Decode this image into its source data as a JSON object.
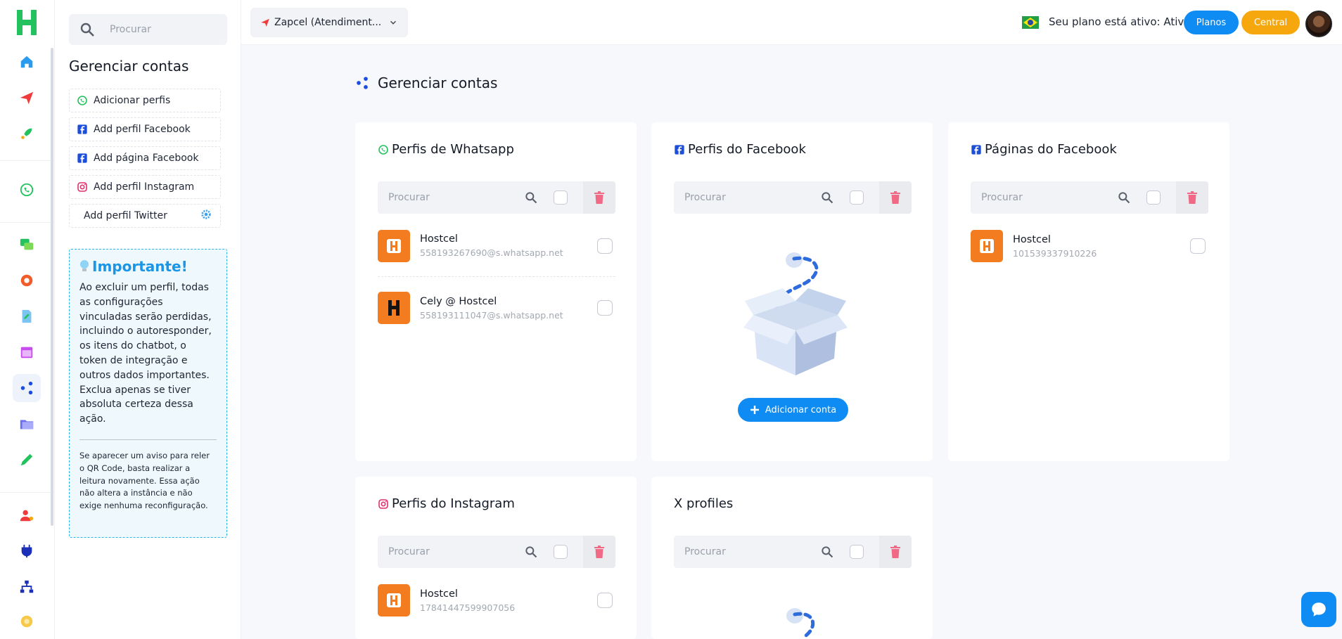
{
  "sidebar_search": {
    "placeholder": "Procurar"
  },
  "panel": {
    "title": "Gerenciar contas",
    "buttons": [
      {
        "label": "Adicionar perfis",
        "icon": "whatsapp-icon"
      },
      {
        "label": "Add perfil Facebook",
        "icon": "facebook-icon"
      },
      {
        "label": "Add página Facebook",
        "icon": "facebook-icon"
      },
      {
        "label": "Add perfil Instagram",
        "icon": "instagram-icon"
      },
      {
        "label": "Add perfil Twitter",
        "icon": "gear-icon"
      }
    ],
    "important": {
      "title": "Importante!",
      "body": "Ao excluir um perfil, todas as configurações vinculadas serão perdidas, incluindo o autoresponder, os itens do chatbot, o token de integração e outros dados importantes. Exclua apenas se tiver absoluta certeza dessa ação.",
      "note": "Se aparecer um aviso para reler o QR Code, basta realizar a leitura novamente. Essa ação não altera a instância e não exige nenhuma reconfiguração."
    }
  },
  "topbar": {
    "account": "Zapcel (Atendiment...",
    "plan_status": "Seu plano está ativo: Ativa",
    "planos": "Planos",
    "central": "Central"
  },
  "main": {
    "title": "Gerenciar contas",
    "search_placeholder": "Procurar",
    "whatsapp": {
      "title": "Perfis de Whatsapp",
      "items": [
        {
          "name": "Hostcel",
          "sub": "558193267690@s.whatsapp.net"
        },
        {
          "name": "Cely @ Hostcel",
          "sub": "558193111047@s.whatsapp.net"
        }
      ]
    },
    "facebook_profiles": {
      "title": "Perfis do Facebook",
      "add_button": "Adicionar conta"
    },
    "facebook_pages": {
      "title": "Páginas do Facebook",
      "items": [
        {
          "name": "Hostcel",
          "sub": "101539337910226"
        }
      ]
    },
    "instagram": {
      "title": "Perfis do Instagram",
      "items": [
        {
          "name": "Hostcel",
          "sub": "17841447599907056"
        }
      ]
    },
    "x_profiles": {
      "title": "X profiles"
    }
  },
  "colors": {
    "primary": "#0f8cf3",
    "accent": "#f7a70e",
    "brand_green": "#22c35e",
    "logo_orange": "#f47c20"
  }
}
